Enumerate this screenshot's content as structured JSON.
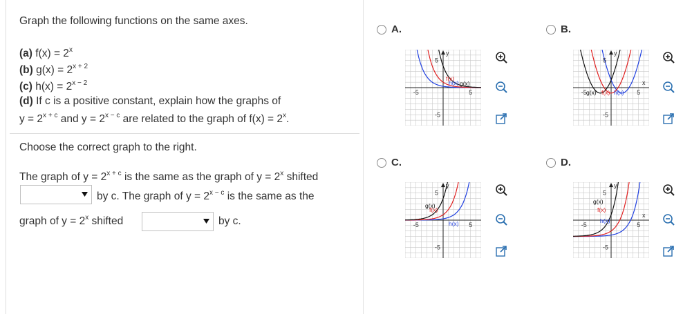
{
  "question": {
    "prompt": "Graph the following functions on the same axes.",
    "a_label": "(a)",
    "a_expr": "f(x) = 2",
    "a_sup": "x",
    "b_label": "(b)",
    "b_expr": "g(x) = 2",
    "b_sup": "x + 2",
    "c_label": "(c)",
    "c_expr": "h(x) = 2",
    "c_sup": "x − 2",
    "d_label": "(d)",
    "d_text": "If c is a positive constant, explain how the graphs of",
    "d2_pre": "y = 2",
    "d2_sup1": "x + c",
    "d2_mid1": " and y = 2",
    "d2_sup2": "x − c",
    "d2_mid2": " are related to the graph of f(x) = 2",
    "d2_sup3": "x",
    "d2_end": "."
  },
  "instruction": "Choose the correct graph to the right.",
  "answer": {
    "l1_pre": "The graph of y = 2",
    "l1_sup1": "x + c",
    "l1_mid": " is the same as the graph of y = 2",
    "l1_sup2": "x",
    "l1_end": " shifted",
    "l2_text": "by c. The graph of y = 2",
    "l2_sup": "x − c",
    "l2_end": " is the same as the",
    "l3_pre": "graph of y = 2",
    "l3_sup": "x",
    "l3_mid": " shifted",
    "l3_end": "by c.",
    "dropdown1_value": "",
    "dropdown2_value": ""
  },
  "options": [
    {
      "letter": "A.",
      "labels": {
        "f": "f(x)",
        "g": "g(x)",
        "h": "h(x)"
      },
      "axis": {
        "y": "y",
        "x": "x",
        "ytick": "5",
        "xtickneg": "-5",
        "xtickpos": "5",
        "ytickneg": "-5"
      }
    },
    {
      "letter": "B.",
      "labels": {
        "f": "f(x)",
        "g": "g(x)",
        "h": "h(x)"
      },
      "axis": {
        "y": "y",
        "x": "x",
        "ytick": "5",
        "xtickneg": "-5",
        "xtickpos": "5",
        "ytickneg": "-5"
      }
    },
    {
      "letter": "C.",
      "labels": {
        "f": "f(x)",
        "g": "g(x)",
        "h": "h(x)"
      },
      "axis": {
        "y": "y",
        "x": "x",
        "ytick": "5",
        "xtickneg": "-5",
        "xtickpos": "5",
        "ytickneg": "-5"
      }
    },
    {
      "letter": "D.",
      "labels": {
        "f": "f(x)",
        "g": "g(x)",
        "h": "h(x)"
      },
      "axis": {
        "y": "y",
        "x": "x",
        "ytick": "5",
        "xtickneg": "-5",
        "xtickpos": "5",
        "ytickneg": "-5"
      }
    }
  ],
  "colors": {
    "f": "#e02020",
    "g": "#111111",
    "h": "#1f3fe0",
    "grid": "#c8c8c8",
    "icon": "#2a6fb0"
  }
}
